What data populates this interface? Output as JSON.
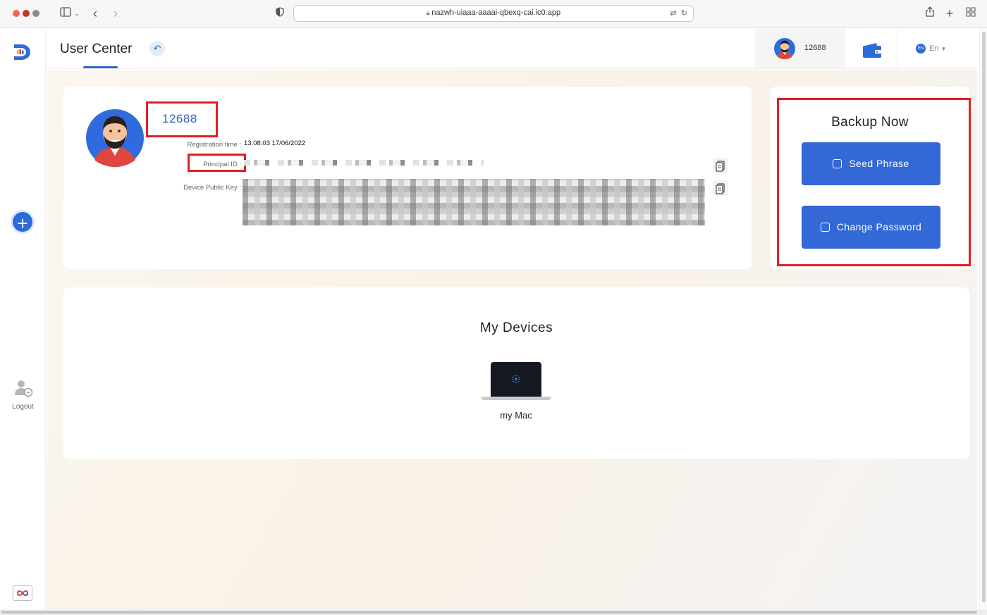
{
  "browser": {
    "url": "nazwh-uiaaa-aaaai-qbexq-cai.ic0.app"
  },
  "sidebar": {
    "logout_label": "Logout"
  },
  "header": {
    "title": "User Center",
    "user_id": "12688",
    "language": "En",
    "language_badge": "EN"
  },
  "profile": {
    "user_name": "12688",
    "registration_label": "Registration time :",
    "registration_value": "13:08:03 17/06/2022",
    "principal_label": "Principal ID :",
    "device_key_label": "Device Public Key :"
  },
  "backup": {
    "title": "Backup Now",
    "seed_phrase_label": "Seed Phrase",
    "change_password_label": "Change Password"
  },
  "devices": {
    "title": "My Devices",
    "items": [
      {
        "name": "my Mac"
      }
    ]
  },
  "colors": {
    "accent": "#3468d6",
    "highlight": "#e31e24",
    "username": "#2d5fc0"
  }
}
